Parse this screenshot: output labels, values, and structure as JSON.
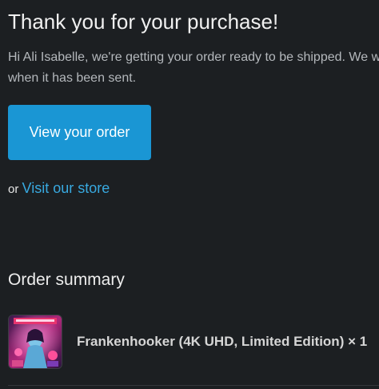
{
  "header": {
    "title": "Thank you for your purchase!"
  },
  "message": {
    "line1": "Hi Ali Isabelle, we're getting your order ready to be shipped. We will notify you",
    "line2": "when it has been sent."
  },
  "actions": {
    "view_order_label": "View your order",
    "or_text": "or",
    "visit_store_label": "Visit our store"
  },
  "summary": {
    "heading": "Order summary",
    "items": [
      {
        "label": "Frankenhooker (4K UHD, Limited Edition) × 1"
      }
    ]
  },
  "colors": {
    "background": "#1c1f22",
    "accent": "#1a96d4",
    "link": "#38a9e0"
  }
}
